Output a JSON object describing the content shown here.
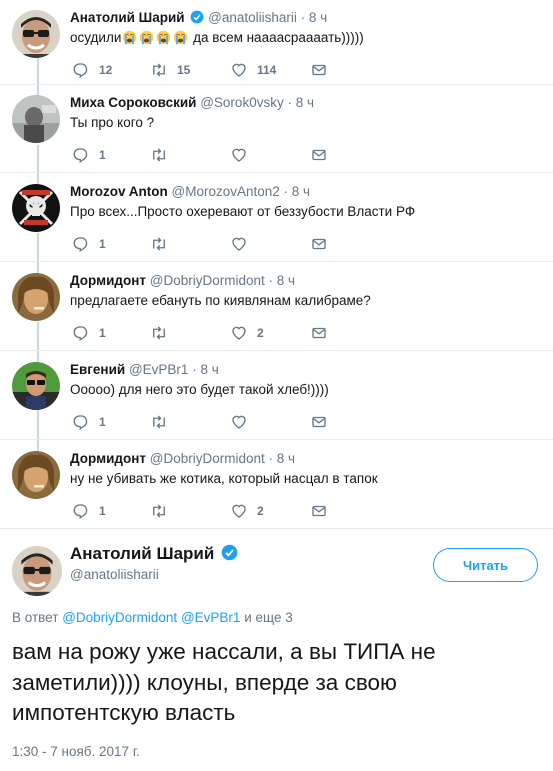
{
  "colors": {
    "accent": "#1da1f2",
    "muted": "#657786",
    "line": "#ccd6dd"
  },
  "tweets": [
    {
      "name": "Анатолий Шарий",
      "verified": true,
      "handle": "@anatoliisharii",
      "dot": "·",
      "time": "8 ч",
      "text_before": "осудили",
      "emoji": [
        "loudly-crying-face",
        "loudly-crying-face",
        "loudly-crying-face",
        "loudly-crying-face"
      ],
      "text_after": " да всем наааасраааать)))))",
      "replies": "12",
      "retweets": "15",
      "likes": "114"
    },
    {
      "name": "Миха Сороковский",
      "handle": "@Sorok0vsky",
      "dot": "·",
      "time": "8 ч",
      "text": "Ты про кого ?",
      "replies": "1",
      "retweets": "",
      "likes": ""
    },
    {
      "name": "Morozov Anton",
      "handle": "@MorozovAnton2",
      "dot": "·",
      "time": "8 ч",
      "text": "Про всех...Просто охеревают от беззубости Власти РФ",
      "replies": "1",
      "retweets": "",
      "likes": ""
    },
    {
      "name": "Дормидонт",
      "handle": "@DobriyDormidont",
      "dot": "·",
      "time": "8 ч",
      "text": "предлагаете ебануть по киявлянам калибраме?",
      "replies": "1",
      "retweets": "",
      "likes": "2"
    },
    {
      "name": "Евгений",
      "handle": "@EvPBr1",
      "dot": "·",
      "time": "8 ч",
      "text": "Ооооо) для него это будет такой хлеб!))))",
      "replies": "1",
      "retweets": "",
      "likes": ""
    },
    {
      "name": "Дормидонт",
      "handle": "@DobriyDormidont",
      "dot": "·",
      "time": "8 ч",
      "text": "ну не убивать же котика, который насцал в тапок",
      "replies": "1",
      "retweets": "",
      "likes": "2"
    }
  ],
  "main": {
    "name": "Анатолий Шарий",
    "verified": true,
    "handle": "@anatoliisharii",
    "follow_label": "Читать",
    "reply_prefix": "В ответ",
    "reply_user1": "@DobriyDormidont",
    "reply_user2": "@EvPBr1",
    "reply_suffix": "и еще 3",
    "text": "вам на рожу уже нассали, а вы ТИПА не заметили)))) клоуны, вперде за свою импотентскую власть",
    "timestamp": "1:30 - 7 нояб. 2017 г."
  }
}
